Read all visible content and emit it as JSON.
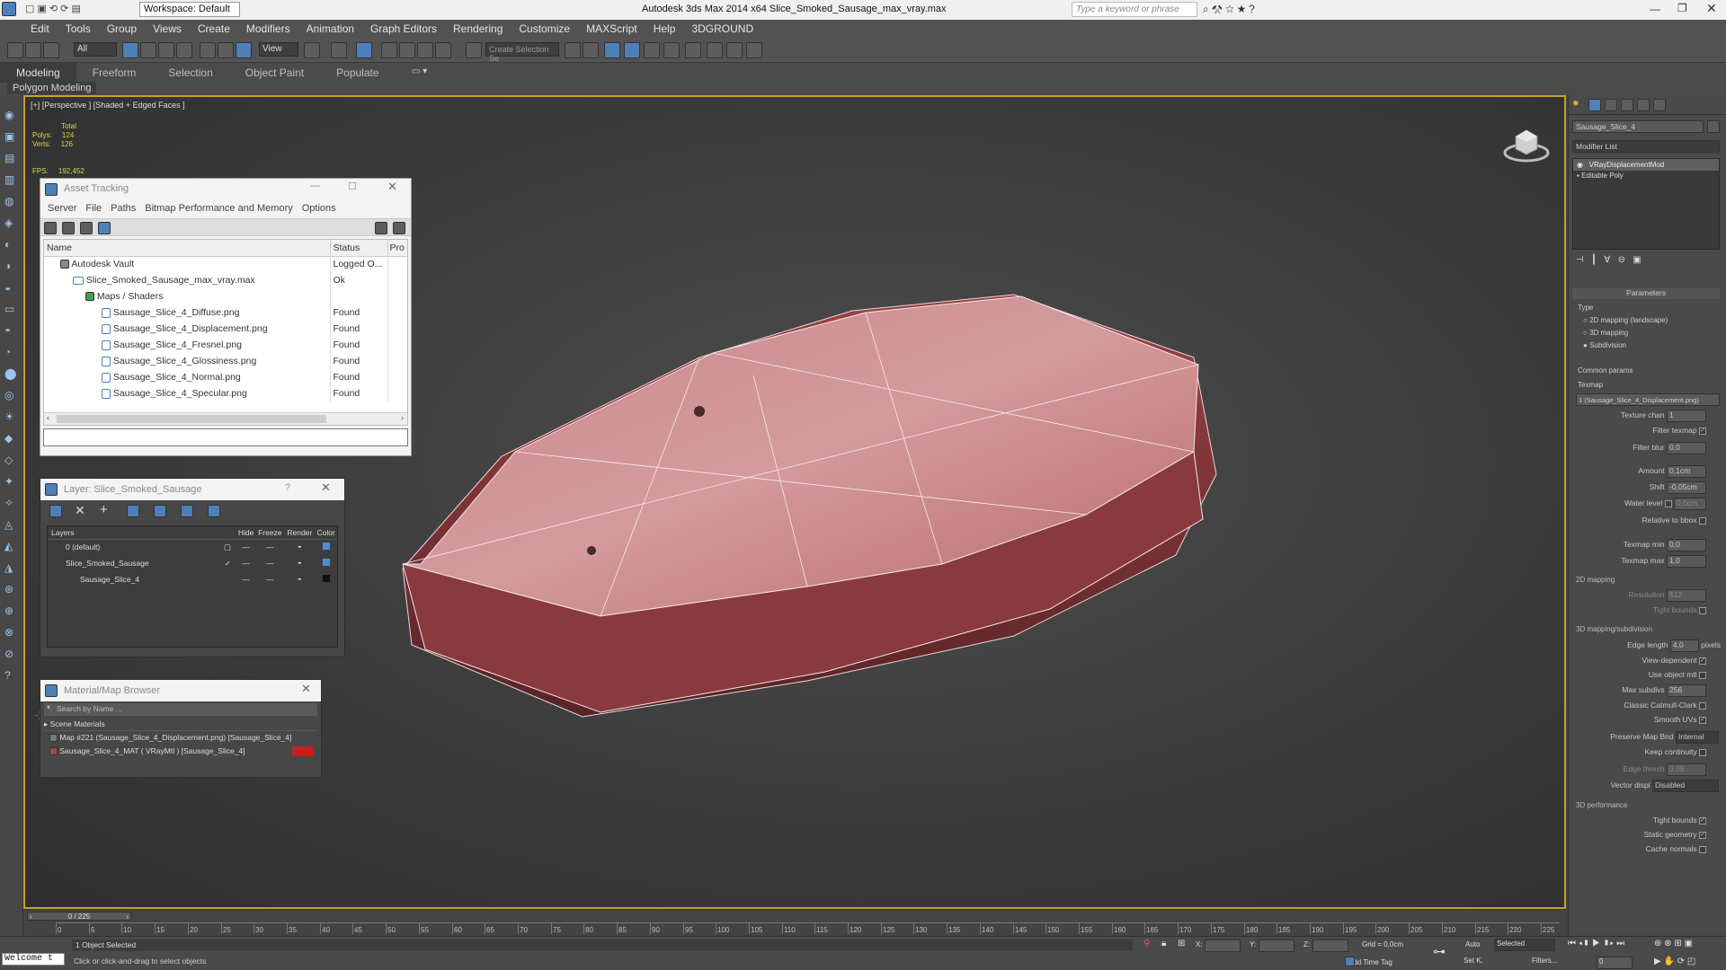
{
  "titlebar": {
    "workspace": "Workspace: Default",
    "title": "Autodesk 3ds Max  2014 x64     Slice_Smoked_Sausage_max_vray.max",
    "search_placeholder": "Type a keyword or phrase"
  },
  "menu": [
    "Edit",
    "Tools",
    "Group",
    "Views",
    "Create",
    "Modifiers",
    "Animation",
    "Graph Editors",
    "Rendering",
    "Customize",
    "MAXScript",
    "Help",
    "3DGROUND"
  ],
  "toolbar": {
    "filter": "All",
    "refcoord": "View",
    "selection_set": "Create Selection Se"
  },
  "ribbon": {
    "tabs": [
      "Modeling",
      "Freeform",
      "Selection",
      "Object Paint",
      "Populate"
    ],
    "sub": "Polygon Modeling"
  },
  "viewport": {
    "label": "[+] [Perspective ] [Shaded + Edged Faces ]",
    "stats": {
      "total": "Total",
      "polys_label": "Polys:",
      "polys": "124",
      "verts_label": "Verts:",
      "verts": "126",
      "fps_label": "FPS:",
      "fps": "192,452"
    }
  },
  "asset_tracking": {
    "title": "Asset Tracking",
    "menu": [
      "Server",
      "File",
      "Paths",
      "Bitmap Performance and Memory",
      "Options"
    ],
    "headers": [
      "Name",
      "Status",
      "Pro"
    ],
    "rows": [
      {
        "name": "Autodesk Vault",
        "status": "Logged O..."
      },
      {
        "name": "Slice_Smoked_Sausage_max_vray.max",
        "status": "Ok"
      },
      {
        "name": "Maps / Shaders",
        "status": ""
      },
      {
        "name": "Sausage_Slice_4_Diffuse.png",
        "status": "Found"
      },
      {
        "name": "Sausage_Slice_4_Displacement.png",
        "status": "Found"
      },
      {
        "name": "Sausage_Slice_4_Fresnel.png",
        "status": "Found"
      },
      {
        "name": "Sausage_Slice_4_Glossiness.png",
        "status": "Found"
      },
      {
        "name": "Sausage_Slice_4_Normal.png",
        "status": "Found"
      },
      {
        "name": "Sausage_Slice_4_Specular.png",
        "status": "Found"
      }
    ]
  },
  "layer": {
    "title": "Layer: Slice_Smoked_Sausage",
    "headers": [
      "Layers",
      "Hide",
      "Freeze",
      "Render",
      "Color"
    ],
    "rows": [
      {
        "name": "0 (default)",
        "color": "#4a8fe0"
      },
      {
        "name": "Slice_Smoked_Sausage",
        "color": "#4a8fe0"
      },
      {
        "name": "Sausage_Slice_4",
        "color": "#111111"
      }
    ]
  },
  "material_browser": {
    "title": "Material/Map Browser",
    "search_placeholder": "Search by Name ...",
    "group": "Scene Materials",
    "items": [
      "Map #221 (Sausage_Slice_4_Displacement.png) [Sausage_Slice_4]",
      "Sausage_Slice_4_MAT ( VRayMtl ) [Sausage_Slice_4]"
    ]
  },
  "right_panel": {
    "object_name": "Sausage_Slice_4",
    "modifier_list": "Modifier List",
    "stack": [
      "VRayDisplacementMod",
      "Editable Poly"
    ],
    "params_title": "Parameters",
    "type_label": "Type",
    "types": [
      "2D mapping (landscape)",
      "3D mapping",
      "Subdivision"
    ],
    "common_params": "Common params",
    "texmap_label": "Texmap",
    "texmap": "1 (Sausage_Slice_4_Displacement.png)",
    "fields": [
      {
        "label": "Texture chan",
        "value": "1"
      },
      {
        "label": "Filter texmap",
        "value": "✓"
      },
      {
        "label": "Filter blur",
        "value": "0,0"
      },
      {
        "label": "Amount",
        "value": "0,1cm"
      },
      {
        "label": "Shift",
        "value": "-0,05cm"
      },
      {
        "label": "Water level",
        "value": "0,0cm"
      },
      {
        "label": "Relative to bbox",
        "value": ""
      },
      {
        "label": "Texmap min",
        "value": "0,0"
      },
      {
        "label": "Texmap max",
        "value": "1,0"
      }
    ],
    "mapping2d_title": "2D mapping",
    "resolution_label": "Resolution",
    "resolution": "512",
    "tight_bounds_label": "Tight bounds",
    "mapping3d_title": "3D mapping/subdivision",
    "fields3d": [
      {
        "label": "Edge length",
        "value": "4,0",
        "unit": "pixels"
      },
      {
        "label": "View-dependent",
        "value": "✓"
      },
      {
        "label": "Use object mtl",
        "value": ""
      },
      {
        "label": "Max subdivs",
        "value": "256"
      },
      {
        "label": "Classic Catmull-Clark",
        "value": ""
      },
      {
        "label": "Smooth UVs",
        "value": "✓"
      },
      {
        "label": "Preserve Map Bnd",
        "value": "Internal"
      },
      {
        "label": "Keep continuity",
        "value": ""
      },
      {
        "label": "Edge thresh",
        "value": "0,05"
      },
      {
        "label": "Vector displ",
        "value": "Disabled"
      }
    ],
    "perf_title": "3D performance",
    "perf": [
      "Tight bounds",
      "Static geometry",
      "Cache normals"
    ]
  },
  "timeline": {
    "frame": "0 / 225",
    "ticks": [
      "0",
      "5",
      "10",
      "15",
      "20",
      "25",
      "30",
      "35",
      "40",
      "45",
      "50",
      "55",
      "60",
      "65",
      "70",
      "75",
      "80",
      "85",
      "90",
      "95",
      "100",
      "105",
      "110",
      "115",
      "120",
      "125",
      "130",
      "135",
      "140",
      "145",
      "150",
      "155",
      "160",
      "165",
      "170",
      "175",
      "180",
      "185",
      "190",
      "195",
      "200",
      "205",
      "210",
      "215",
      "220",
      "225"
    ]
  },
  "status": {
    "welcome": "Welcome t",
    "selected": "1 Object Selected",
    "hint": "Click or click-and-drag to select objects",
    "x": "X:",
    "y": "Y:",
    "z": "Z:",
    "grid": "Grid = 0,0cm",
    "auto": "Auto",
    "setk": "Set K.",
    "selected_dd": "Selected",
    "filters": "Filters...",
    "add_time_tag": "Add Time Tag",
    "frame_field": "0"
  }
}
